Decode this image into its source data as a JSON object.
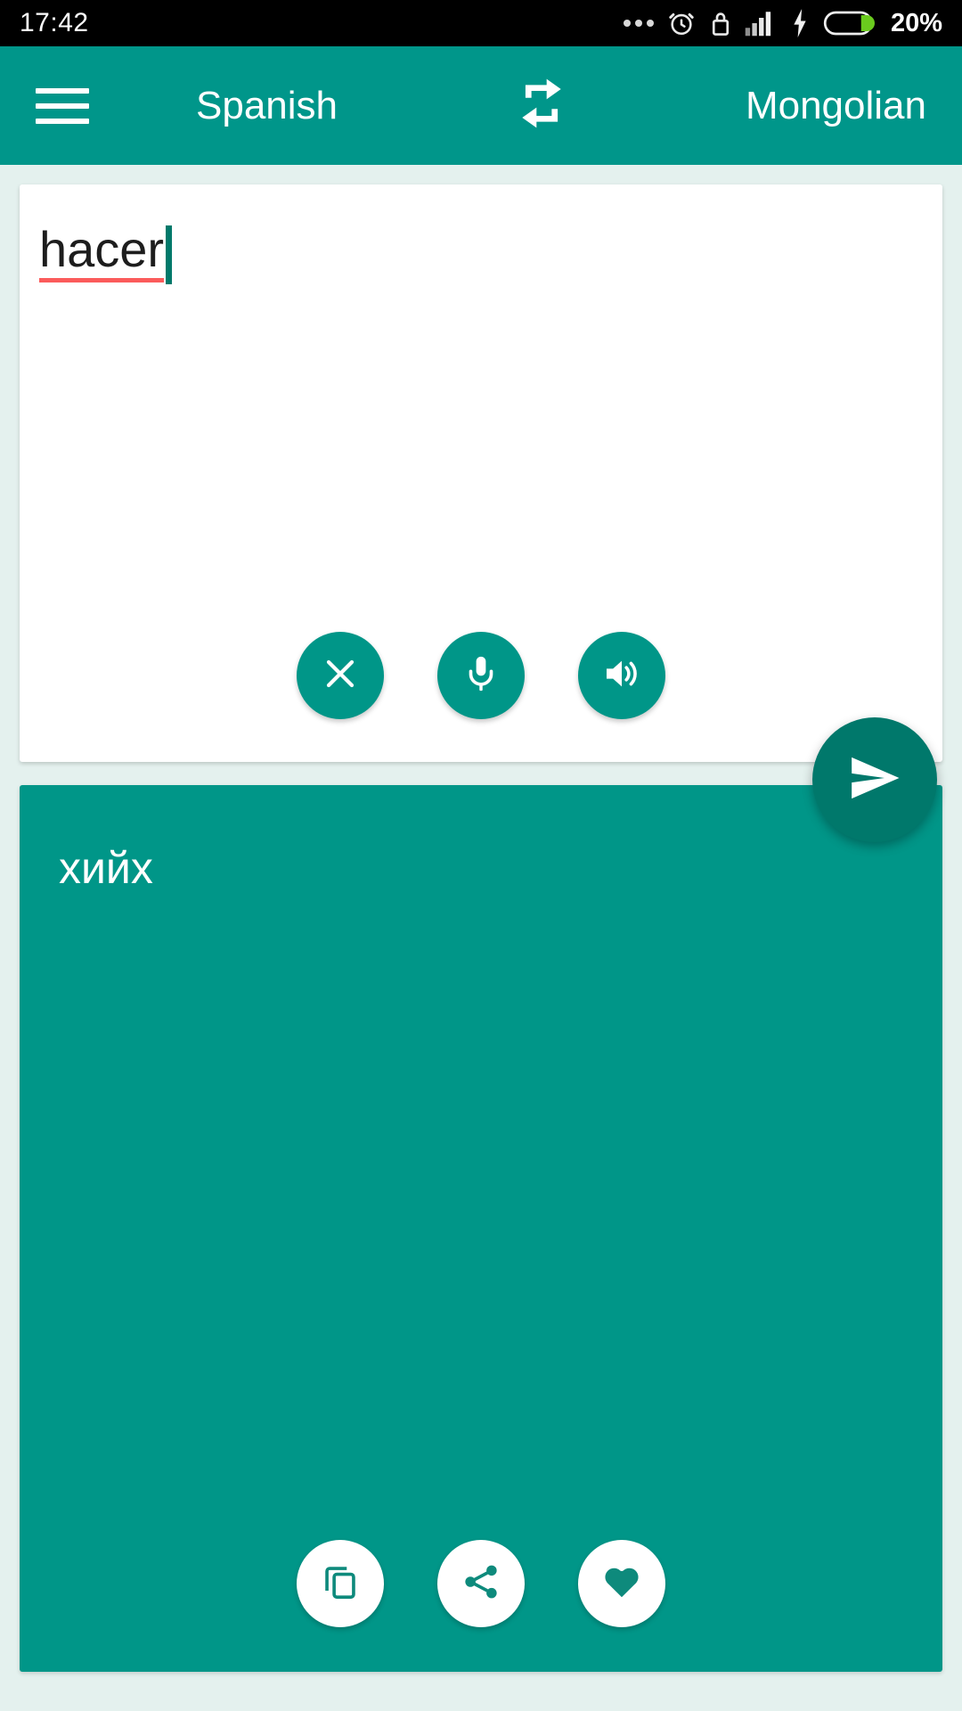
{
  "status_bar": {
    "time": "17:42",
    "battery_percent": "20%",
    "icons": [
      "more-dots-icon",
      "alarm-clock-icon",
      "lock-icon",
      "signal-bars-icon",
      "charging-bolt-icon",
      "battery-icon"
    ]
  },
  "header": {
    "menu_icon": "hamburger-menu-icon",
    "source_language": "Spanish",
    "swap_icon": "swap-languages-icon",
    "target_language": "Mongolian"
  },
  "input_card": {
    "text": "hacer",
    "spellcheck_underline": true,
    "caret_visible": true,
    "buttons": [
      {
        "name": "clear-button",
        "icon": "close-x-icon",
        "label": "Clear"
      },
      {
        "name": "microphone-button",
        "icon": "microphone-icon",
        "label": "Voice input"
      },
      {
        "name": "speak-source-button",
        "icon": "speaker-icon",
        "label": "Listen"
      }
    ]
  },
  "send_button": {
    "icon": "send-icon",
    "label": "Translate"
  },
  "output_card": {
    "text": "хийх",
    "buttons": [
      {
        "name": "copy-button",
        "icon": "copy-icon",
        "label": "Copy"
      },
      {
        "name": "share-button",
        "icon": "share-icon",
        "label": "Share"
      },
      {
        "name": "favorite-button",
        "icon": "heart-icon",
        "label": "Favorite"
      }
    ]
  },
  "colors": {
    "brand_teal": "#009688",
    "header_teal": "#00968A",
    "fab_teal": "#00786B",
    "page_background": "#E4F1EE",
    "spellcheck_red": "#FB5B5B",
    "status_bar": "#000000",
    "battery_green": "#6ACB1E"
  }
}
